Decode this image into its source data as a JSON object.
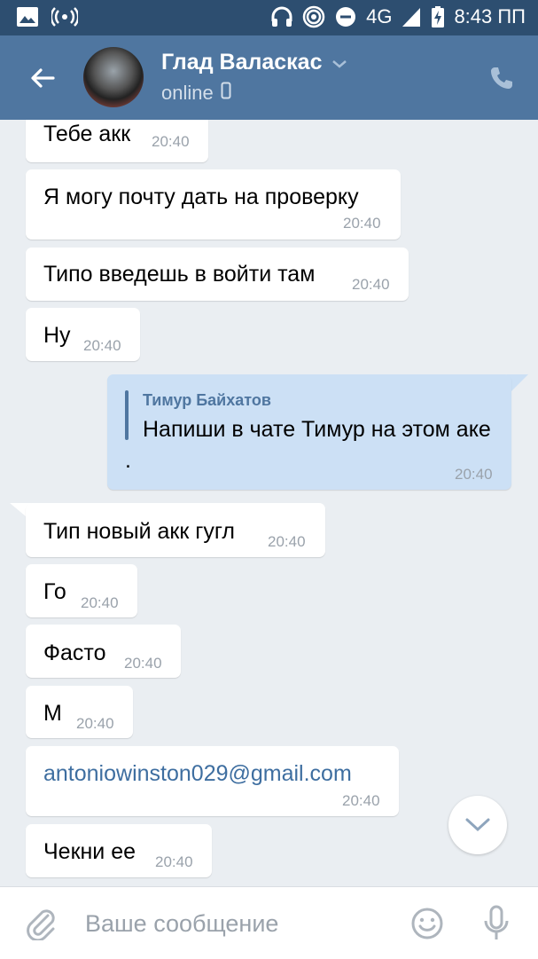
{
  "status_bar": {
    "network": "4G",
    "network_small": "4G",
    "time": "8:43 ПП",
    "icons": [
      "image-icon",
      "hotspot-icon",
      "headphones-icon",
      "location-icon",
      "dnd-icon",
      "signal-icon",
      "battery-charging-icon"
    ]
  },
  "header": {
    "contact_name": "Глад Валаскас",
    "status": "online",
    "icons": [
      "back-arrow-icon",
      "chevron-down-icon",
      "mobile-icon",
      "phone-icon"
    ]
  },
  "messages": [
    {
      "text": "Тебе акк",
      "time": "20:40",
      "direction": "in"
    },
    {
      "text": "Я могу почту дать на проверку",
      "time": "20:40",
      "direction": "in"
    },
    {
      "text": "Типо введешь в войти там",
      "time": "20:40",
      "direction": "in"
    },
    {
      "text": "Ну",
      "time": "20:40",
      "direction": "in"
    },
    {
      "reply_name": "Тимур Байхатов",
      "text": "Напиши в чате Тимур на этом аке",
      "extra": ".",
      "time": "20:40",
      "direction": "out"
    },
    {
      "text": "Тип новый акк гугл",
      "time": "20:40",
      "direction": "in"
    },
    {
      "text": "Го",
      "time": "20:40",
      "direction": "in"
    },
    {
      "text": "Фасто",
      "time": "20:40",
      "direction": "in"
    },
    {
      "text": "М",
      "time": "20:40",
      "direction": "in"
    },
    {
      "text": "antoniowinston029@gmail.com",
      "time": "20:40",
      "direction": "in",
      "is_link": true
    },
    {
      "text": "Чекни ее",
      "time": "20:40",
      "direction": "in"
    }
  ],
  "composer": {
    "placeholder": "Ваше сообщение",
    "icons": [
      "attach-icon",
      "emoji-icon",
      "mic-icon"
    ]
  },
  "colors": {
    "status_bar": "#2d4e70",
    "header": "#4f76a0",
    "background": "#eaeef2",
    "outgoing_bubble": "#cce0f5",
    "link": "#3e6ea0"
  }
}
